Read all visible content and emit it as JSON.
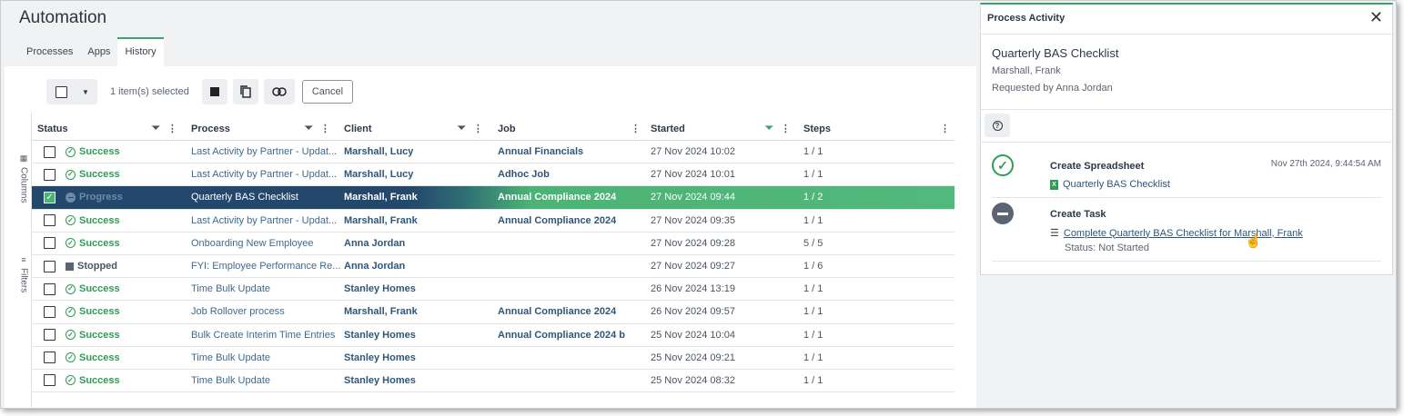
{
  "app": {
    "title": "Automation"
  },
  "tabs": [
    {
      "label": "Processes",
      "active": false
    },
    {
      "label": "Apps",
      "active": false
    },
    {
      "label": "History",
      "active": true
    }
  ],
  "toolbar": {
    "selection_text": "1 item(s) selected",
    "cancel_label": "Cancel"
  },
  "side_rail": {
    "columns_label": "Columns",
    "filters_label": "Filters"
  },
  "table": {
    "headers": {
      "status": "Status",
      "process": "Process",
      "client": "Client",
      "job": "Job",
      "started": "Started",
      "steps": "Steps"
    },
    "rows": [
      {
        "status": "Success",
        "process": "Last Activity by Partner - Updat...",
        "client": "Marshall, Lucy",
        "job": "Annual Financials",
        "started": "27 Nov 2024 10:02",
        "steps": "1 / 1",
        "selected": false
      },
      {
        "status": "Success",
        "process": "Last Activity by Partner - Updat...",
        "client": "Marshall, Lucy",
        "job": "Adhoc Job",
        "started": "27 Nov 2024 10:01",
        "steps": "1 / 1",
        "selected": false
      },
      {
        "status": "Progress",
        "process": "Quarterly BAS Checklist",
        "client": "Marshall, Frank",
        "job": "Annual Compliance 2024",
        "started": "27 Nov 2024 09:44",
        "steps": "1 / 2",
        "selected": true
      },
      {
        "status": "Success",
        "process": "Last Activity by Partner - Updat...",
        "client": "Marshall, Frank",
        "job": "Annual Compliance 2024",
        "started": "27 Nov 2024 09:35",
        "steps": "1 / 1",
        "selected": false
      },
      {
        "status": "Success",
        "process": "Onboarding New Employee",
        "client": "Anna Jordan",
        "job": "",
        "started": "27 Nov 2024 09:28",
        "steps": "5 / 5",
        "selected": false
      },
      {
        "status": "Stopped",
        "process": "FYI: Employee Performance Re...",
        "client": "Anna Jordan",
        "job": "",
        "started": "27 Nov 2024 09:27",
        "steps": "1 / 6",
        "selected": false
      },
      {
        "status": "Success",
        "process": "Time Bulk Update",
        "client": "Stanley Homes",
        "job": "",
        "started": "26 Nov 2024 13:19",
        "steps": "1 / 1",
        "selected": false
      },
      {
        "status": "Success",
        "process": "Job Rollover process",
        "client": "Marshall, Frank",
        "job": "Annual Compliance 2024",
        "started": "26 Nov 2024 09:57",
        "steps": "1 / 1",
        "selected": false
      },
      {
        "status": "Success",
        "process": "Bulk Create Interim Time Entries",
        "client": "Stanley Homes",
        "job": "Annual Compliance 2024 b",
        "started": "25 Nov 2024 10:04",
        "steps": "1 / 1",
        "selected": false
      },
      {
        "status": "Success",
        "process": "Time Bulk Update",
        "client": "Stanley Homes",
        "job": "",
        "started": "25 Nov 2024 09:21",
        "steps": "1 / 1",
        "selected": false
      },
      {
        "status": "Success",
        "process": "Time Bulk Update",
        "client": "Stanley Homes",
        "job": "",
        "started": "25 Nov 2024 08:32",
        "steps": "1 / 1",
        "selected": false
      }
    ]
  },
  "panel": {
    "title": "Process Activity",
    "process_name": "Quarterly BAS Checklist",
    "client": "Marshall, Frank",
    "requested_by": "Requested by Anna Jordan",
    "activities": [
      {
        "title": "Create Spreadsheet",
        "timestamp": "Nov 27th 2024, 9:44:54 AM",
        "item": "Quarterly BAS Checklist",
        "state": "complete"
      },
      {
        "title": "Create Task",
        "item": "Complete Quarterly BAS Checklist for Marshall, Frank",
        "status": "Status: Not Started",
        "state": "blocked"
      }
    ]
  },
  "colors": {
    "accent": "#3aa36a",
    "success": "#2e9c55",
    "selected_row_dark": "#24486b",
    "selected_row_green": "#52b97c",
    "link": "#2f5679"
  }
}
